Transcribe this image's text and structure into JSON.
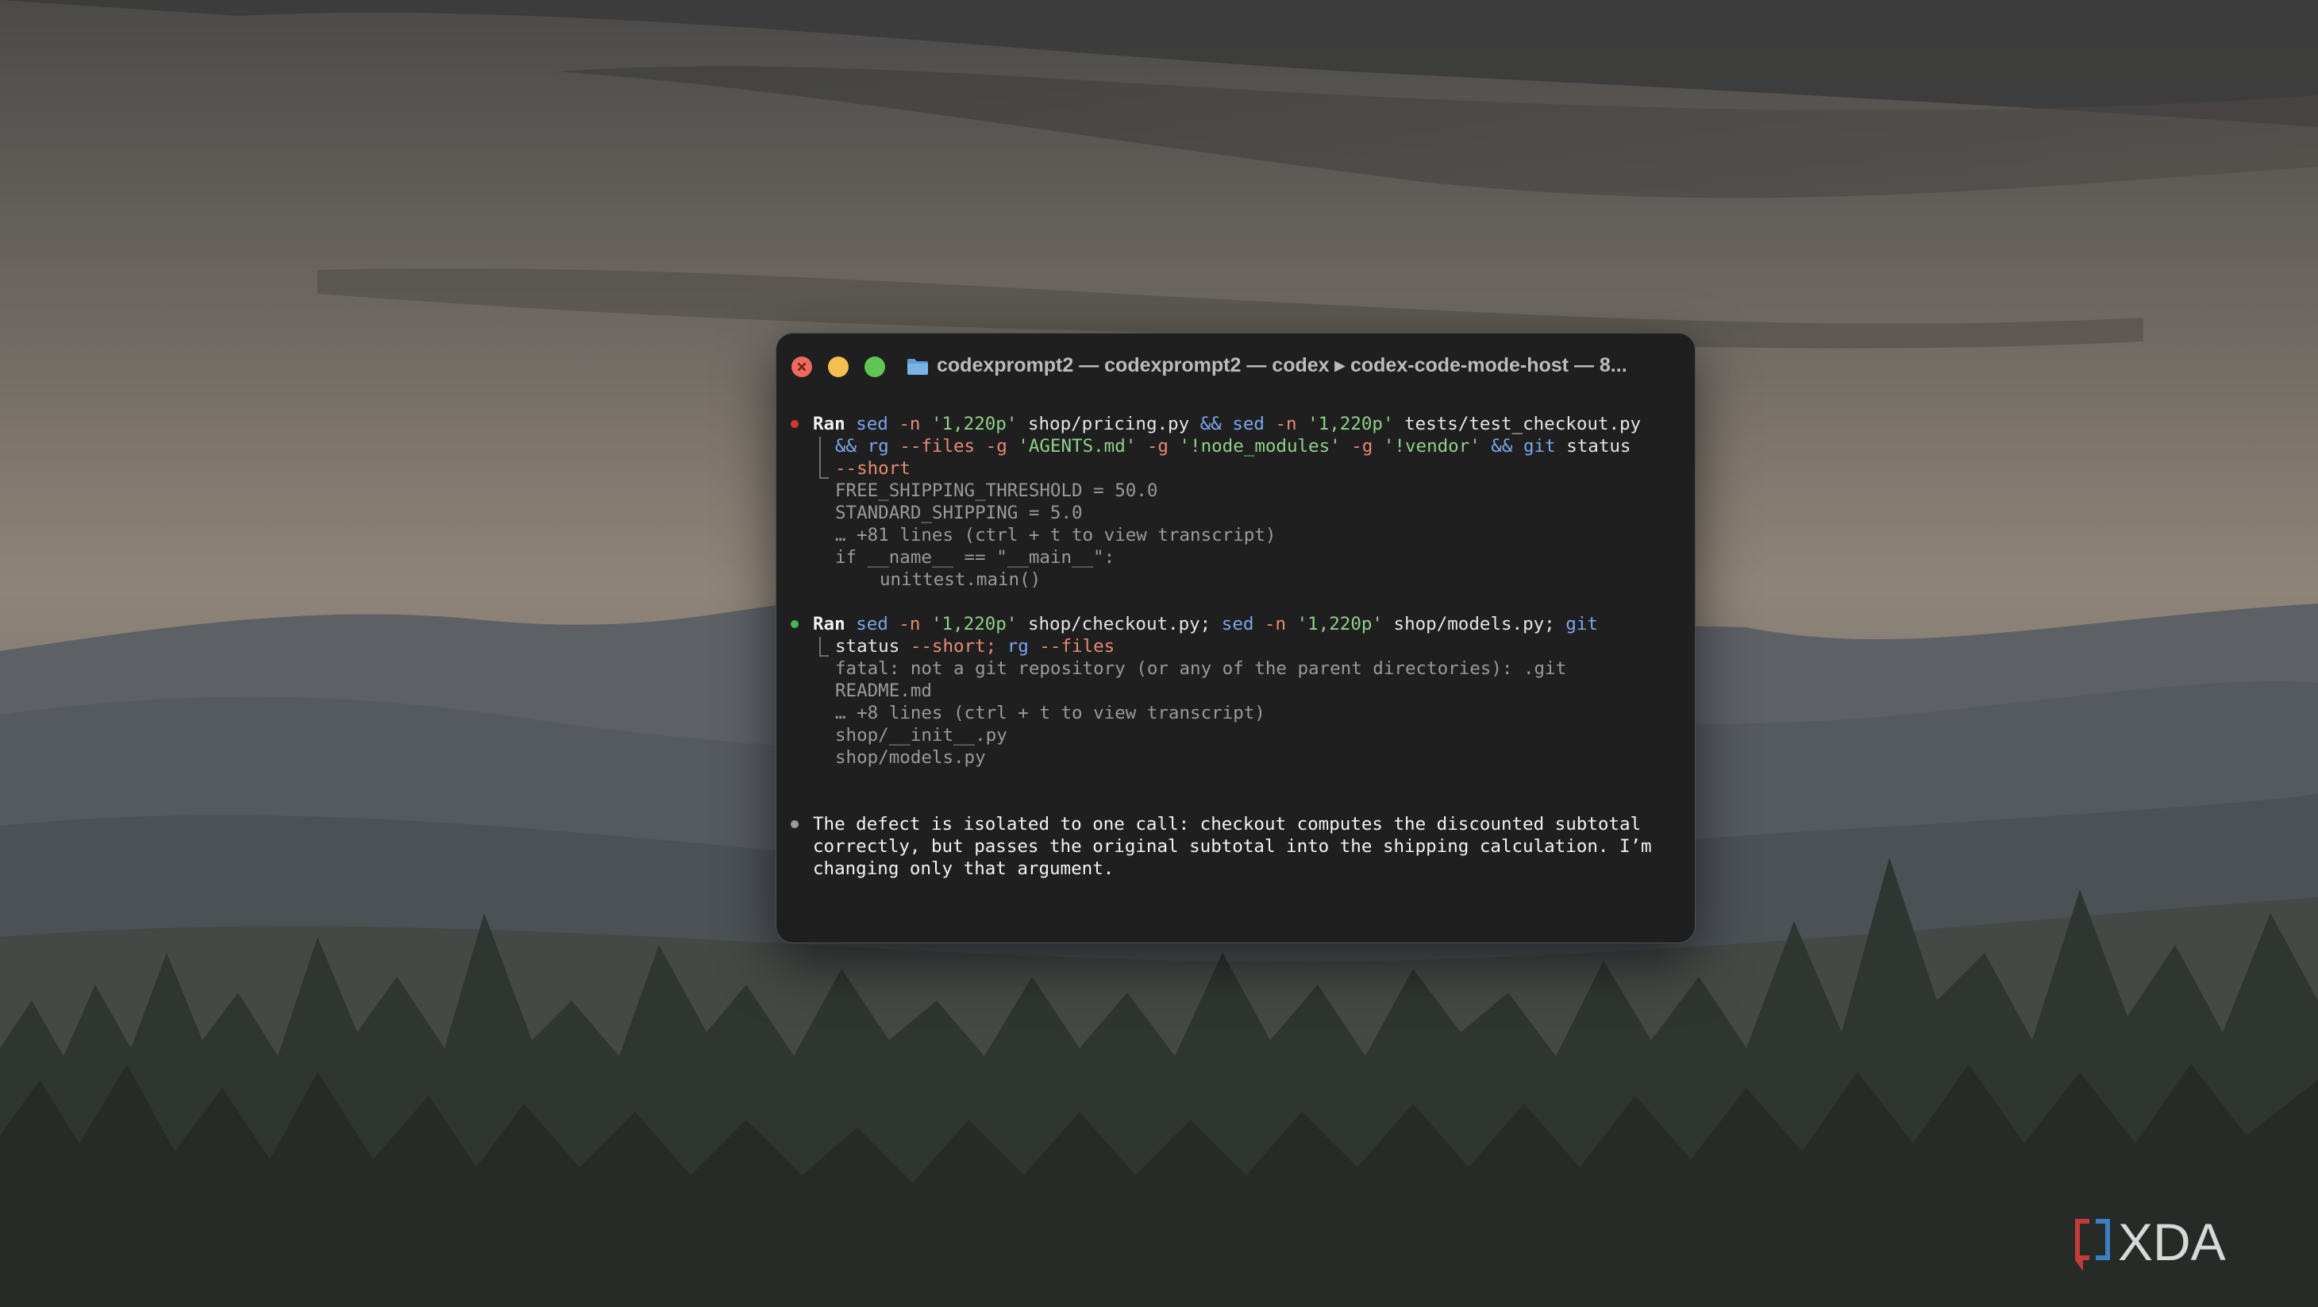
{
  "window": {
    "title": "codexprompt2 — codexprompt2 — codex ▸ codex-code-mode-host — 8..."
  },
  "block1": {
    "bullet_color": "#d13b34",
    "cmd_line1": [
      {
        "t": "Ran ",
        "c": "ran"
      },
      {
        "t": "sed ",
        "c": "kw"
      },
      {
        "t": "-n ",
        "c": "op"
      },
      {
        "t": "'1,220p' ",
        "c": "str"
      },
      {
        "t": "shop/pricing.py ",
        "c": "pl"
      },
      {
        "t": "&& ",
        "c": "kw"
      },
      {
        "t": "sed ",
        "c": "kw"
      },
      {
        "t": "-n ",
        "c": "op"
      },
      {
        "t": "'1,220p' ",
        "c": "str"
      },
      {
        "t": "tests/test_checkout.py",
        "c": "pl"
      }
    ],
    "cmd_line2": [
      {
        "t": "&& ",
        "c": "kw"
      },
      {
        "t": "rg ",
        "c": "kw"
      },
      {
        "t": "--files ",
        "c": "op"
      },
      {
        "t": "-g ",
        "c": "op"
      },
      {
        "t": "'AGENTS.md' ",
        "c": "str"
      },
      {
        "t": "-g ",
        "c": "op"
      },
      {
        "t": "'!node_modules' ",
        "c": "str"
      },
      {
        "t": "-g ",
        "c": "op"
      },
      {
        "t": "'!vendor' ",
        "c": "str"
      },
      {
        "t": "&& ",
        "c": "kw"
      },
      {
        "t": "git ",
        "c": "kw"
      },
      {
        "t": "status",
        "c": "pl"
      }
    ],
    "cmd_line3": [
      {
        "t": "--short",
        "c": "op"
      }
    ],
    "output": [
      "FREE_SHIPPING_THRESHOLD = 50.0",
      "STANDARD_SHIPPING = 5.0",
      "… +81 lines (ctrl + t to view transcript)",
      "if __name__ == \"__main__\":"
    ],
    "output_indented": "unittest.main()"
  },
  "block2": {
    "bullet_color": "#3fb950",
    "cmd_line1": [
      {
        "t": "Ran ",
        "c": "ran"
      },
      {
        "t": "sed ",
        "c": "kw"
      },
      {
        "t": "-n ",
        "c": "op"
      },
      {
        "t": "'1,220p' ",
        "c": "str"
      },
      {
        "t": "shop/checkout.py; ",
        "c": "pl"
      },
      {
        "t": "sed ",
        "c": "kw"
      },
      {
        "t": "-n ",
        "c": "op"
      },
      {
        "t": "'1,220p' ",
        "c": "str"
      },
      {
        "t": "shop/models.py; ",
        "c": "pl"
      },
      {
        "t": "git",
        "c": "kw"
      }
    ],
    "cmd_line2": [
      {
        "t": "status ",
        "c": "pl"
      },
      {
        "t": "--short; ",
        "c": "op"
      },
      {
        "t": "rg ",
        "c": "kw"
      },
      {
        "t": "--files",
        "c": "op"
      }
    ],
    "output": [
      "fatal: not a git repository (or any of the parent directories): .git",
      "README.md",
      "… +8 lines (ctrl + t to view transcript)",
      "shop/__init__.py",
      "shop/models.py"
    ]
  },
  "message": {
    "bullet_color": "#9a9a9a",
    "lines": [
      "The defect is isolated to one call: checkout computes the discounted subtotal",
      "correctly, but passes the original subtotal into the shipping calculation. I’m",
      "changing only that argument."
    ]
  },
  "icons": {
    "folder": "folder-icon",
    "close": "close-icon",
    "minimize": "minimize-icon",
    "maximize": "maximize-icon"
  },
  "watermark": {
    "brand": "XDA"
  }
}
